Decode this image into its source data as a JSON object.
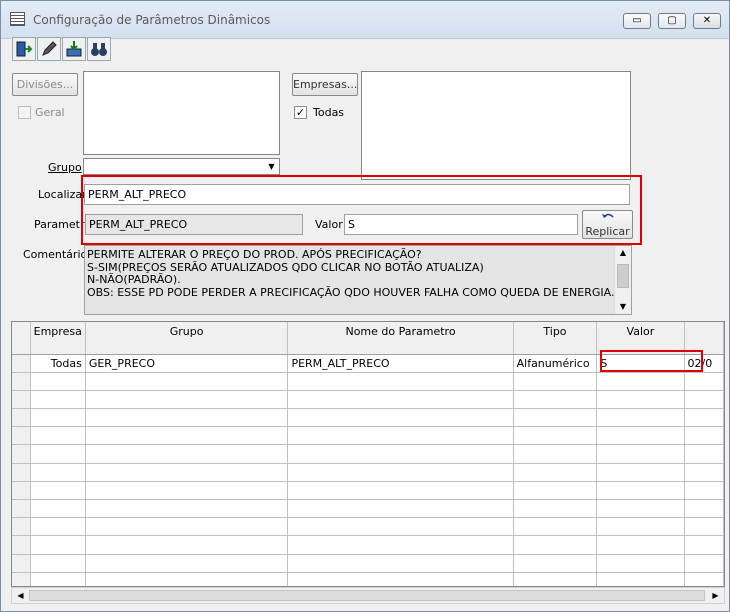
{
  "window": {
    "title": "Configuração de Parâmetros Dinâmicos",
    "minimize": "▭",
    "maximize": "▢",
    "close": "✕"
  },
  "toolbar": {
    "icons": [
      "exit-icon",
      "edit-icon",
      "save-icon",
      "binoculars-search-icon"
    ]
  },
  "divisoes": {
    "button": "Divisões...",
    "geral_label": "Geral",
    "geral_checked": false
  },
  "empresas": {
    "button": "Empresas...",
    "todas_label": "Todas",
    "todas_checked": true,
    "check_glyph": "✓"
  },
  "grupo": {
    "label": "Grupo",
    "value": ""
  },
  "localizar": {
    "label": "Localizar",
    "value": "PERM_ALT_PRECO"
  },
  "parametro": {
    "label": "Parametro",
    "value": "PERM_ALT_PRECO"
  },
  "valor": {
    "label": "Valor",
    "value": "S"
  },
  "replicar": {
    "label": "Replicar"
  },
  "comentarios": {
    "label": "Comentários",
    "lines": [
      "PERMITE ALTERAR O PREÇO DO PROD. APÓS PRECIFICAÇÃO?",
      "S-SIM(PREÇOS SERÃO ATUALIZADOS QDO CLICAR NO BOTÃO ATUALIZA)",
      "N-NÃO(PADRÃO).",
      "OBS: ESSE PD PODE PERDER A PRECIFICAÇÃO QDO HOUVER FALHA COMO QUEDA DE ENERGIA."
    ]
  },
  "grid": {
    "columns": [
      "Empresa",
      "Grupo",
      "Nome do Parametro",
      "Tipo",
      "Valor",
      ""
    ],
    "rows": [
      [
        "Todas",
        "GER_PRECO",
        "PERM_ALT_PRECO",
        "Alfanumérico",
        "S",
        "02/0"
      ]
    ],
    "empty_rows": 12
  },
  "highlight_color": "#e00000"
}
